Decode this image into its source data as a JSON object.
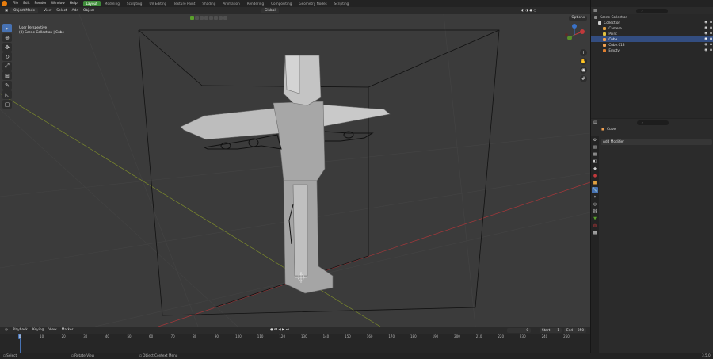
{
  "menu": {
    "items": [
      "File",
      "Edit",
      "Render",
      "Window",
      "Help"
    ]
  },
  "workspaces": [
    "Layout",
    "Modeling",
    "Sculpting",
    "UV Editing",
    "Texture Paint",
    "Shading",
    "Animation",
    "Rendering",
    "Compositing",
    "Geometry Nodes",
    "Scripting"
  ],
  "scene": {
    "name": "Scene",
    "view_layer": "ViewLayer"
  },
  "viewport_header": {
    "mode": "Object Mode",
    "menus": [
      "View",
      "Select",
      "Add",
      "Object"
    ],
    "orientation": "Global",
    "options_label": "Options"
  },
  "viewport": {
    "perspective": "User Perspective",
    "context": "(0) Scene Collection | Cube"
  },
  "outliner": {
    "root": "Scene Collection",
    "items": [
      {
        "label": "Collection",
        "color": "#cfcfcf"
      },
      {
        "label": "Camera",
        "color": "#e0a040"
      },
      {
        "label": "Point",
        "color": "#e0c040"
      },
      {
        "label": "Cube",
        "color": "#f0a050"
      },
      {
        "label": "Cube.018",
        "color": "#f0a050"
      },
      {
        "label": "Empty",
        "color": "#e08030"
      }
    ],
    "selected_index": 3
  },
  "properties": {
    "object_name": "Cube",
    "add_modifier": "Add Modifier"
  },
  "timeline": {
    "menus": [
      "Playback",
      "Keying",
      "View",
      "Marker"
    ],
    "current_frame": "0",
    "start_label": "Start",
    "start": "1",
    "end_label": "End",
    "end": "250",
    "ticks": [
      "0",
      "10",
      "20",
      "30",
      "40",
      "50",
      "60",
      "70",
      "80",
      "90",
      "100",
      "110",
      "120",
      "130",
      "140",
      "150",
      "160",
      "170",
      "180",
      "190",
      "200",
      "210",
      "220",
      "230",
      "240",
      "250"
    ],
    "playhead_frame": "0"
  },
  "status": {
    "select": "Select",
    "rotate": "Rotate View",
    "context_menu": "Object Context Menu",
    "version": "3.5.0"
  }
}
